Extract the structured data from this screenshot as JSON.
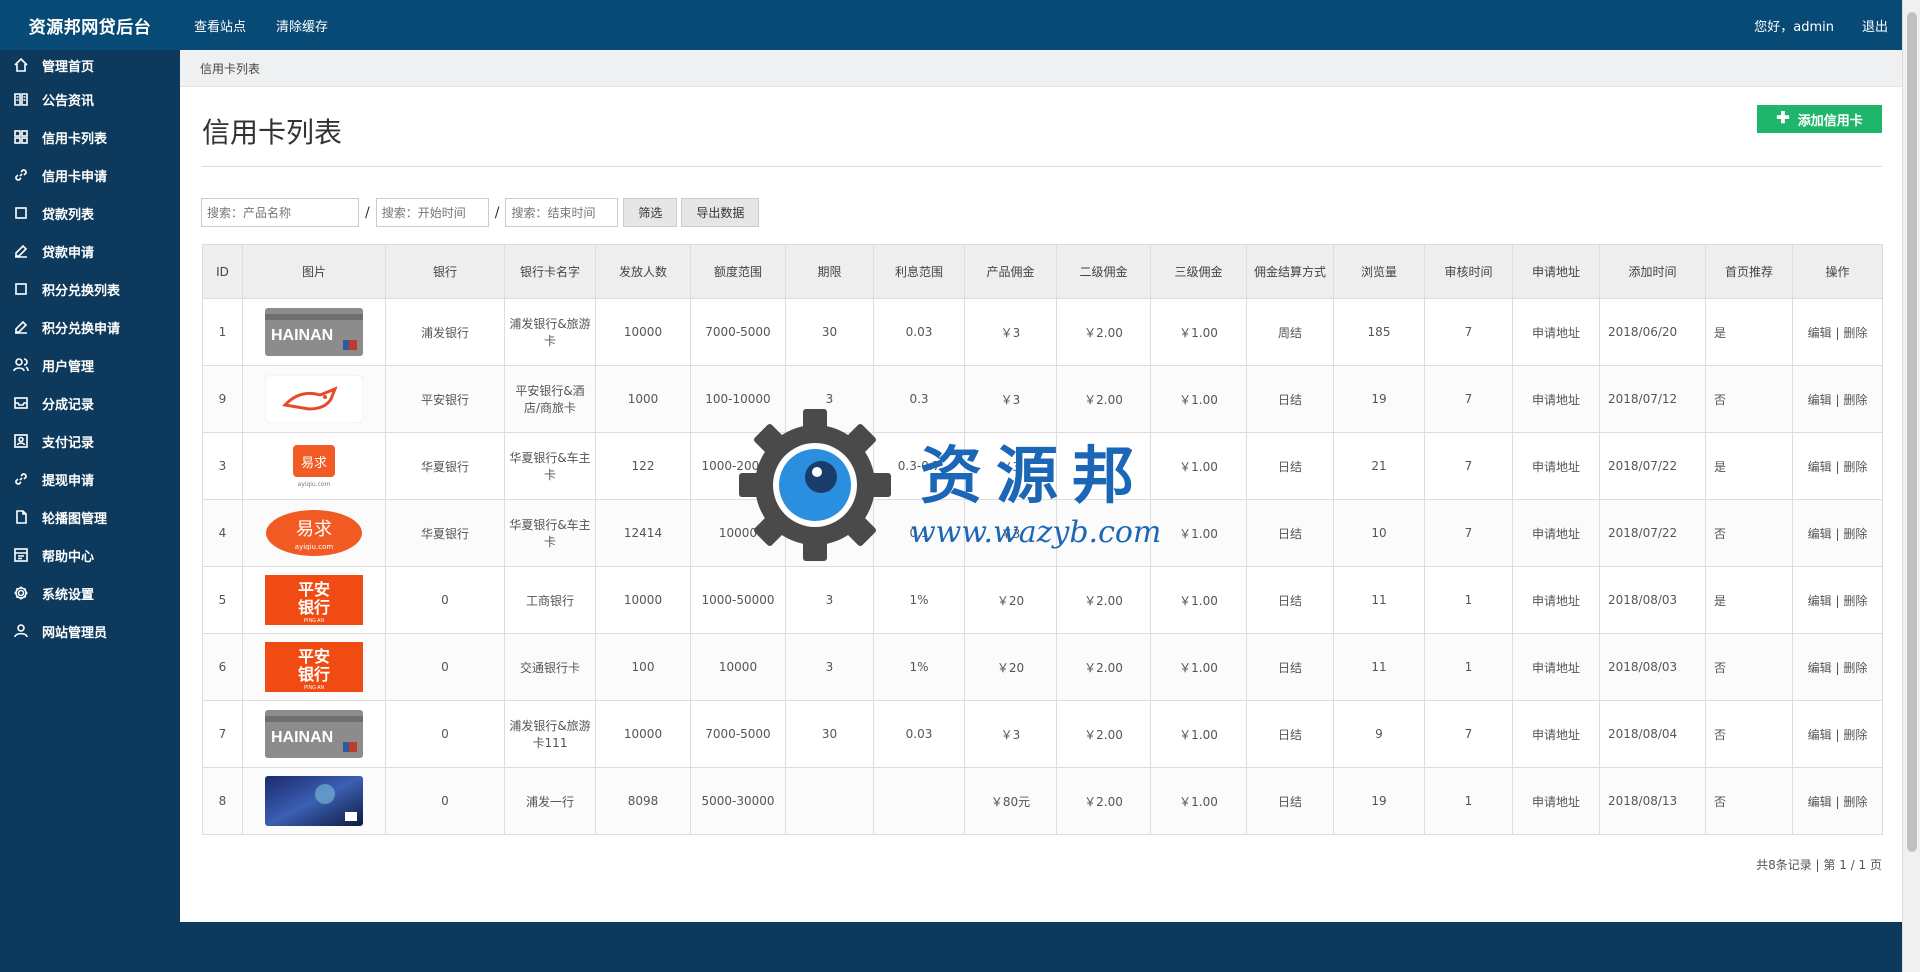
{
  "brand": "资源邦网贷后台",
  "top_links": [
    "查看站点",
    "清除缓存"
  ],
  "greeting": "您好，admin",
  "logout": "退出",
  "sidebar": {
    "items": [
      {
        "label": "管理首页",
        "icon": "home-icon"
      },
      {
        "label": "公告资讯",
        "icon": "book-icon"
      },
      {
        "label": "信用卡列表",
        "icon": "grid-icon"
      },
      {
        "label": "信用卡申请",
        "icon": "link-icon"
      },
      {
        "label": "贷款列表",
        "icon": "square-icon"
      },
      {
        "label": "贷款申请",
        "icon": "edit-icon"
      },
      {
        "label": "积分兑换列表",
        "icon": "square-icon"
      },
      {
        "label": "积分兑换申请",
        "icon": "edit-icon"
      },
      {
        "label": "用户管理",
        "icon": "users-icon"
      },
      {
        "label": "分成记录",
        "icon": "inbox-icon"
      },
      {
        "label": "支付记录",
        "icon": "id-card-icon"
      },
      {
        "label": "提现申请",
        "icon": "link-icon"
      },
      {
        "label": "轮播图管理",
        "icon": "file-icon"
      },
      {
        "label": "帮助中心",
        "icon": "help-icon"
      },
      {
        "label": "系统设置",
        "icon": "gear-icon"
      },
      {
        "label": "网站管理员",
        "icon": "user-icon"
      }
    ]
  },
  "breadcrumb": "信用卡列表",
  "page_title": "信用卡列表",
  "add_button": "添加信用卡",
  "filters": {
    "name_placeholder": "搜索：产品名称",
    "start_placeholder": "搜索：开始时间",
    "end_placeholder": "搜索：结束时间",
    "separator": "/",
    "filter_button": "筛选",
    "export_button": "导出数据"
  },
  "table": {
    "headers": [
      "ID",
      "图片",
      "银行",
      "银行卡名字",
      "发放人数",
      "额度范围",
      "期限",
      "利息范围",
      "产品佣金",
      "二级佣金",
      "三级佣金",
      "佣金结算方式",
      "浏览量",
      "审核时间",
      "申请地址",
      "添加时间",
      "首页推荐",
      "操作"
    ],
    "rows": [
      {
        "id": "1",
        "image": "hainan-card",
        "bank": "浦发银行",
        "name": "浦发银行&旅游卡",
        "count": "10000",
        "range": "7000-5000",
        "term": "30",
        "interest": "0.03",
        "c1": "￥3",
        "c2": "￥2.00",
        "c3": "￥1.00",
        "settle": "周结",
        "views": "185",
        "audit": "7",
        "addr": "申请地址",
        "date": "2018/06/20",
        "rec": "是"
      },
      {
        "id": "9",
        "image": "fox-logo",
        "bank": "平安银行",
        "name": "平安银行&酒店/商旅卡",
        "count": "1000",
        "range": "100-10000",
        "term": "3",
        "interest": "0.3",
        "c1": "￥3",
        "c2": "￥2.00",
        "c3": "￥1.00",
        "settle": "日结",
        "views": "19",
        "audit": "7",
        "addr": "申请地址",
        "date": "2018/07/12",
        "rec": "否"
      },
      {
        "id": "3",
        "image": "yiqiu-square",
        "bank": "华夏银行",
        "name": "华夏银行&车主卡",
        "count": "122",
        "range": "1000-20000",
        "term": "",
        "interest": "0.3-0.7",
        "c1": "￥3",
        "c2": "",
        "c3": "￥1.00",
        "settle": "日结",
        "views": "21",
        "audit": "7",
        "addr": "申请地址",
        "date": "2018/07/22",
        "rec": "是"
      },
      {
        "id": "4",
        "image": "yiqiu-oval",
        "bank": "华夏银行",
        "name": "华夏银行&车主卡",
        "count": "12414",
        "range": "10000",
        "term": "7",
        "interest": "0.1",
        "c1": "￥3",
        "c2": "",
        "c3": "￥1.00",
        "settle": "日结",
        "views": "10",
        "audit": "7",
        "addr": "申请地址",
        "date": "2018/07/22",
        "rec": "否"
      },
      {
        "id": "5",
        "image": "pingan-logo",
        "bank": "0",
        "name": "工商银行",
        "count": "10000",
        "range": "1000-50000",
        "term": "3",
        "interest": "1%",
        "c1": "￥20",
        "c2": "￥2.00",
        "c3": "￥1.00",
        "settle": "日结",
        "views": "11",
        "audit": "1",
        "addr": "申请地址",
        "date": "2018/08/03",
        "rec": "是"
      },
      {
        "id": "6",
        "image": "pingan-logo",
        "bank": "0",
        "name": "交通银行卡",
        "count": "100",
        "range": "10000",
        "term": "3",
        "interest": "1%",
        "c1": "￥20",
        "c2": "￥2.00",
        "c3": "￥1.00",
        "settle": "日结",
        "views": "11",
        "audit": "1",
        "addr": "申请地址",
        "date": "2018/08/03",
        "rec": "否"
      },
      {
        "id": "7",
        "image": "hainan-card",
        "bank": "0",
        "name": "浦发银行&旅游卡111",
        "count": "10000",
        "range": "7000-5000",
        "term": "30",
        "interest": "0.03",
        "c1": "￥3",
        "c2": "￥2.00",
        "c3": "￥1.00",
        "settle": "日结",
        "views": "9",
        "audit": "7",
        "addr": "申请地址",
        "date": "2018/08/04",
        "rec": "否"
      },
      {
        "id": "8",
        "image": "space-card",
        "bank": "0",
        "name": "浦发一行",
        "count": "8098",
        "range": "5000-30000",
        "term": "",
        "interest": "",
        "c1": "￥80元",
        "c2": "￥2.00",
        "c3": "￥1.00",
        "settle": "日结",
        "views": "19",
        "audit": "1",
        "addr": "申请地址",
        "date": "2018/08/13",
        "rec": "否"
      }
    ],
    "op_edit": "编辑",
    "op_sep": " | ",
    "op_delete": "删除"
  },
  "pager": "共8条记录 | 第 1 / 1 页",
  "watermark": {
    "cn": "资源邦",
    "url": "www.wazyb.com"
  },
  "card_text": {
    "hainan": "HAINAN",
    "yiqiu": "易求",
    "yiqiu_url": "ayiqiu.com",
    "pingan_1": "平安",
    "pingan_2": "银行",
    "pingan_en": "PING AN"
  },
  "colors": {
    "topbar": "#074a76",
    "sidebar": "#0d3a5c",
    "accent_green": "#1fb56a",
    "watermark_blue": "#1b66b6"
  }
}
